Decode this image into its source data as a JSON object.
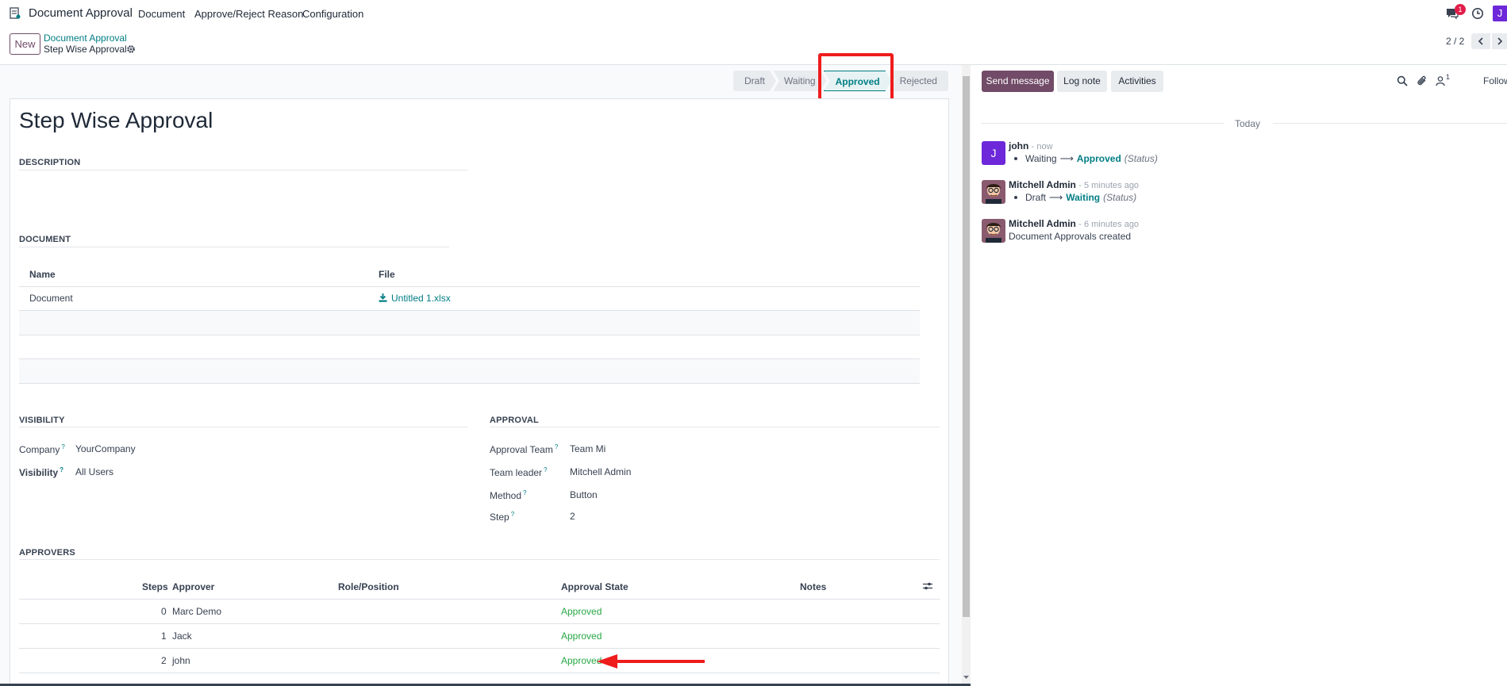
{
  "navbar": {
    "app_name": "Document Approval",
    "menus": [
      "Document",
      "Approve/Reject Reason",
      "Configuration"
    ],
    "message_badge": "1",
    "user_initial": "J"
  },
  "control_panel": {
    "new_label": "New",
    "breadcrumb_parent": "Document Approval",
    "breadcrumb_current": "Step Wise Approval",
    "pager": "2 / 2"
  },
  "statusbar": {
    "stages": [
      "Draft",
      "Waiting",
      "Approved",
      "Rejected"
    ],
    "active": "Approved"
  },
  "form": {
    "title": "Step Wise Approval",
    "description_label": "DESCRIPTION",
    "document_label": "DOCUMENT",
    "document_table": {
      "headers": [
        "Name",
        "File"
      ],
      "rows": [
        {
          "name": "Document",
          "file": "Untitled 1.xlsx"
        }
      ]
    },
    "visibility_section": {
      "label": "VISIBILITY",
      "company_label": "Company",
      "company_value": "YourCompany",
      "visibility_label": "Visibility",
      "visibility_value": "All Users"
    },
    "approval_section": {
      "label": "APPROVAL",
      "team_label": "Approval Team",
      "team_value": "Team Mi",
      "leader_label": "Team leader",
      "leader_value": "Mitchell Admin",
      "method_label": "Method",
      "method_value": "Button",
      "step_label": "Step",
      "step_value": "2"
    },
    "approvers": {
      "label": "APPROVERS",
      "headers": [
        "Steps",
        "Approver",
        "Role/Position",
        "Approval State",
        "Notes"
      ],
      "rows": [
        {
          "step": "0",
          "approver": "Marc Demo",
          "state": "Approved"
        },
        {
          "step": "1",
          "approver": "Jack",
          "state": "Approved"
        },
        {
          "step": "2",
          "approver": "john",
          "state": "Approved"
        }
      ]
    }
  },
  "chatter": {
    "send_message": "Send message",
    "log_note": "Log note",
    "activities": "Activities",
    "followers_count": "1",
    "follow_label": "Follow",
    "date_separator": "Today",
    "messages": [
      {
        "author": "john",
        "time": "- now",
        "from": "Waiting",
        "to": "Approved",
        "field": "(Status)"
      },
      {
        "author": "Mitchell Admin",
        "time": "- 5 minutes ago",
        "from": "Draft",
        "to": "Waiting",
        "field": "(Status)"
      },
      {
        "author": "Mitchell Admin",
        "time": "- 6 minutes ago",
        "body": "Document Approvals created"
      }
    ]
  },
  "colors": {
    "brand": "#714b67",
    "link": "#017e84",
    "approved": "#28a745",
    "annotation_red": "#ef1c1c",
    "avatar_purple": "#6d28d9"
  }
}
